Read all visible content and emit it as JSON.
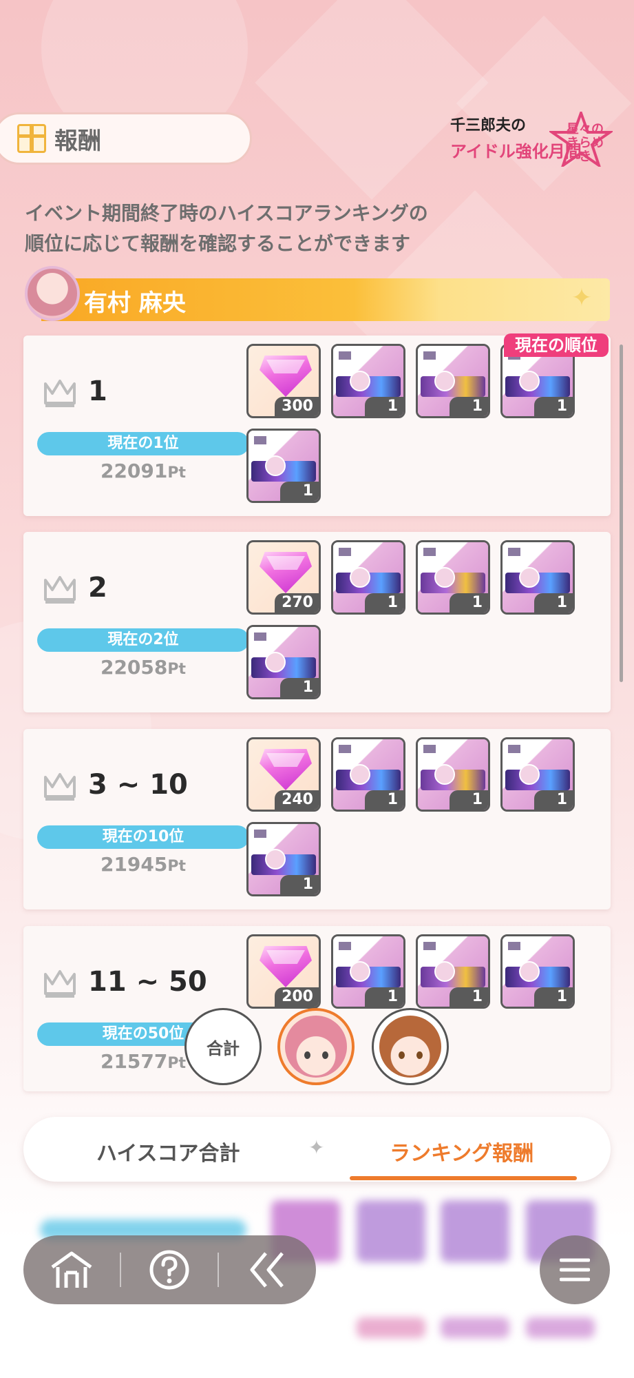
{
  "header": {
    "tab_label": "報酬",
    "event_logo": {
      "line1": "千三郎夫の",
      "line2": "アイドル強化月間",
      "line3": "星々のきらめき"
    }
  },
  "description": {
    "line1": "イベント期間終了時のハイスコアランキングの",
    "line2": "順位に応じて報酬を確認することができます"
  },
  "character": {
    "name": "有村 麻央"
  },
  "current_rank_badge": "現在の順位",
  "rewards": [
    {
      "rank": "1",
      "current_label": "現在の1位",
      "score": "22091",
      "unit": "Pt",
      "jewel_qty": "300",
      "ticket_qtys": [
        "1",
        "1",
        "1",
        "1"
      ]
    },
    {
      "rank": "2",
      "current_label": "現在の2位",
      "score": "22058",
      "unit": "Pt",
      "jewel_qty": "270",
      "ticket_qtys": [
        "1",
        "1",
        "1",
        "1"
      ]
    },
    {
      "rank": "3 ~ 10",
      "current_label": "現在の10位",
      "score": "21945",
      "unit": "Pt",
      "jewel_qty": "240",
      "ticket_qtys": [
        "1",
        "1",
        "1",
        "1"
      ]
    },
    {
      "rank": "11 ~ 50",
      "current_label": "現在の50位",
      "score": "21577",
      "unit": "Pt",
      "jewel_qty": "200",
      "ticket_qtys": [
        "1",
        "1",
        "1"
      ]
    }
  ],
  "selector": {
    "total_label": "合計"
  },
  "segmented_tabs": {
    "tab1": "ハイスコア合計",
    "tab2": "ランキング報酬",
    "active": "tab2"
  },
  "colors": {
    "accent": "#ee7b2c",
    "pill": "#5ec8ea",
    "badge": "#ef3e7c",
    "charbar": "#f9a825"
  }
}
